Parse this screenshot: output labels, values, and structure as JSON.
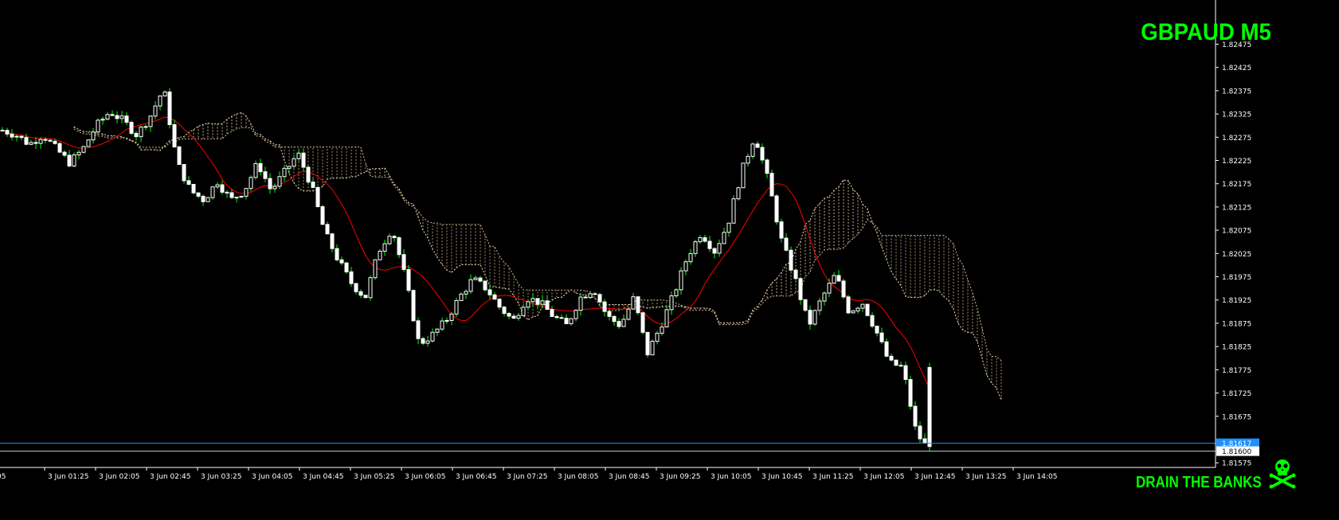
{
  "symbol": "GBPAUD M5",
  "watermark": "DRAIN THE BANKS",
  "colors": {
    "background": "#000000",
    "bull_candle": "#ffffff",
    "bear_candle": "#ffffff",
    "wick": "#00ff00",
    "moving_average": "#ff0000",
    "kumo_bull": "#f5deb3",
    "kumo_bear": "#d2b48c",
    "axis_text": "#ffffff",
    "current_price_line": "#1e90ff",
    "low_price_line": "#c0c0c0",
    "title": "#00ff00"
  },
  "chart_data": {
    "type": "candlestick",
    "title": "GBPAUD M5",
    "ylim": [
      1.8157,
      1.825
    ],
    "y_ticks": [
      "1.82475",
      "1.82425",
      "1.82375",
      "1.82325",
      "1.82275",
      "1.82225",
      "1.82175",
      "1.82125",
      "1.82075",
      "1.82025",
      "1.81975",
      "1.81925",
      "1.81875",
      "1.81825",
      "1.81775",
      "1.81725",
      "1.81675",
      "1.81575"
    ],
    "x_ticks": [
      "05",
      "3 Jun 01:25",
      "3 Jun 02:05",
      "3 Jun 02:45",
      "3 Jun 03:25",
      "3 Jun 04:05",
      "3 Jun 04:45",
      "3 Jun 05:25",
      "3 Jun 06:05",
      "3 Jun 06:45",
      "3 Jun 07:25",
      "3 Jun 08:05",
      "3 Jun 08:45",
      "3 Jun 09:25",
      "3 Jun 10:05",
      "3 Jun 10:45",
      "3 Jun 11:25",
      "3 Jun 12:05",
      "3 Jun 12:45",
      "3 Jun 13:25",
      "3 Jun 14:05"
    ],
    "price_labels": {
      "current": "1.81617",
      "low": "1.81600"
    },
    "close_path": [
      1.8229,
      1.8228,
      1.8226,
      1.8228,
      1.8225,
      1.8222,
      1.8225,
      1.823,
      1.8233,
      1.8231,
      1.8228,
      1.8232,
      1.8238,
      1.8222,
      1.8216,
      1.8214,
      1.8218,
      1.8214,
      1.8216,
      1.8222,
      1.8216,
      1.822,
      1.8224,
      1.8217,
      1.8207,
      1.8201,
      1.8196,
      1.8193,
      1.8203,
      1.8208,
      1.8197,
      1.8183,
      1.8185,
      1.8188,
      1.8193,
      1.8197,
      1.8195,
      1.8191,
      1.8188,
      1.8193,
      1.8192,
      1.8189,
      1.8187,
      1.8193,
      1.8195,
      1.8189,
      1.8187,
      1.8193,
      1.8181,
      1.8187,
      1.8194,
      1.8202,
      1.8207,
      1.8203,
      1.8209,
      1.822,
      1.8228,
      1.8218,
      1.8205,
      1.8197,
      1.8187,
      1.8193,
      1.8198,
      1.819,
      1.8192,
      1.8186,
      1.8179,
      1.8178,
      1.8164,
      1.816
    ]
  }
}
